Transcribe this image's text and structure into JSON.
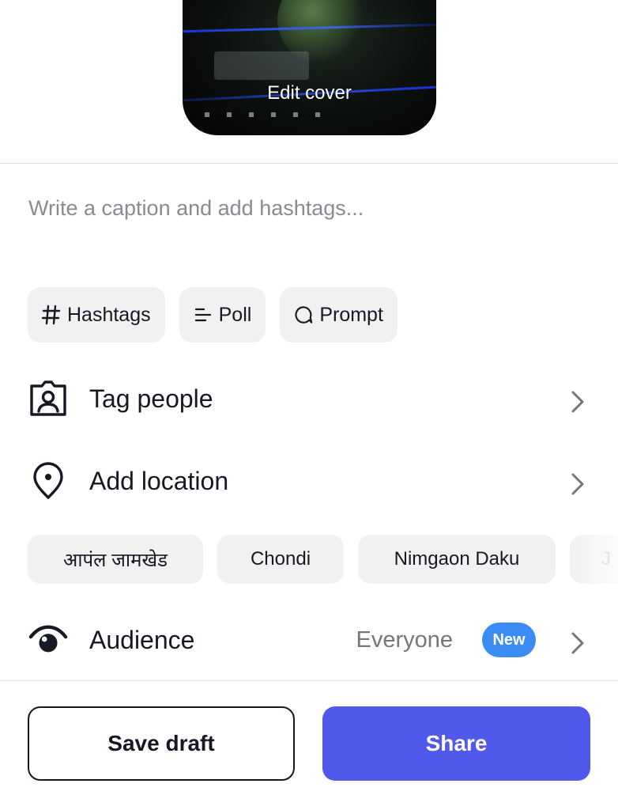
{
  "cover": {
    "edit_label": "Edit cover"
  },
  "caption": {
    "placeholder": "Write a caption and add hashtags..."
  },
  "chips": [
    {
      "label": "Hashtags",
      "icon": "hash-icon"
    },
    {
      "label": "Poll",
      "icon": "poll-icon"
    },
    {
      "label": "Prompt",
      "icon": "prompt-icon"
    }
  ],
  "rows": {
    "tag_people": {
      "label": "Tag people",
      "icon": "person-tag-icon"
    },
    "add_location": {
      "label": "Add location",
      "icon": "location-pin-icon"
    },
    "audience": {
      "label": "Audience",
      "icon": "eye-icon",
      "value": "Everyone",
      "badge": "New"
    }
  },
  "location_suggestions": [
    "आपंल जामखेड",
    "Chondi",
    "Nimgaon Daku",
    "J"
  ],
  "actions": {
    "save_draft": "Save draft",
    "share": "Share"
  },
  "colors": {
    "share_button": "#5159ed",
    "new_badge": "#3c8cf5",
    "chip_background": "#f1f1f2",
    "placeholder_text": "#8a8b91"
  }
}
